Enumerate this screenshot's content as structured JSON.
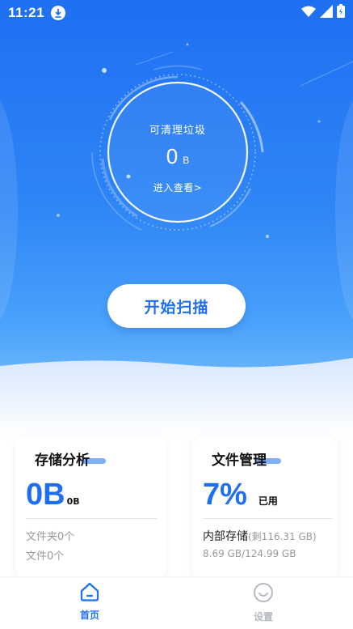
{
  "status_bar": {
    "time": "11:21"
  },
  "gauge": {
    "label": "可清理垃圾",
    "value": "0",
    "unit": "B",
    "link": "进入查看>"
  },
  "scan_button": "开始扫描",
  "storage_card": {
    "title": "存储分析",
    "value": "0B",
    "unit": "0B",
    "folders": "文件夹0个",
    "files": "文件0个"
  },
  "file_card": {
    "title": "文件管理",
    "percent": "7%",
    "used_label": "已用",
    "internal_label": "内部存储",
    "remaining": "(剩116.31 GB)",
    "usage": "8.69 GB/124.99 GB"
  },
  "tabs": [
    {
      "label": "首页",
      "icon": "home-icon",
      "active": true
    },
    {
      "label": "设置",
      "icon": "smiley-icon",
      "active": false
    }
  ],
  "colors": {
    "accent": "#1f6ff2",
    "hero_top": "#1f6ff2",
    "inactive": "#b5b9c2"
  }
}
